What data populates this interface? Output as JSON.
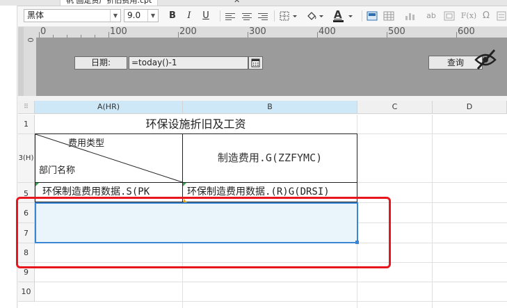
{
  "tab": {
    "label": "帆 固定资产折旧费用.cpt"
  },
  "toolbar": {
    "font_name": "黑体",
    "font_size": "9.0",
    "bold": "B",
    "italic": "I",
    "underline": "U",
    "text_color_icon": "A",
    "text_icon": "ab",
    "formula_icon": "F(x)",
    "omega_icon": "Ω"
  },
  "ruler": {
    "ticks": [
      "0",
      "100",
      "200",
      "300",
      "400",
      "500",
      "600"
    ],
    "vertical_tick": "0"
  },
  "parameter_panel": {
    "date_label": "日期:",
    "date_value": "=today()-1",
    "query_button": "查询"
  },
  "grid": {
    "columns": [
      "A(HR)",
      "B",
      "C",
      "D"
    ],
    "rows": [
      "1",
      "3(H)",
      "5",
      "6",
      "7",
      "8",
      "9",
      "10"
    ],
    "title": "环保设施折旧及工资",
    "header_top": "费用类型",
    "header_bottom": "部门名称",
    "b3": "制造费用.G(ZZFYMC)",
    "a5": "环保制造费用数据.S(PK_",
    "b5": "环保制造费用数据.(R)G(DRSI)"
  }
}
